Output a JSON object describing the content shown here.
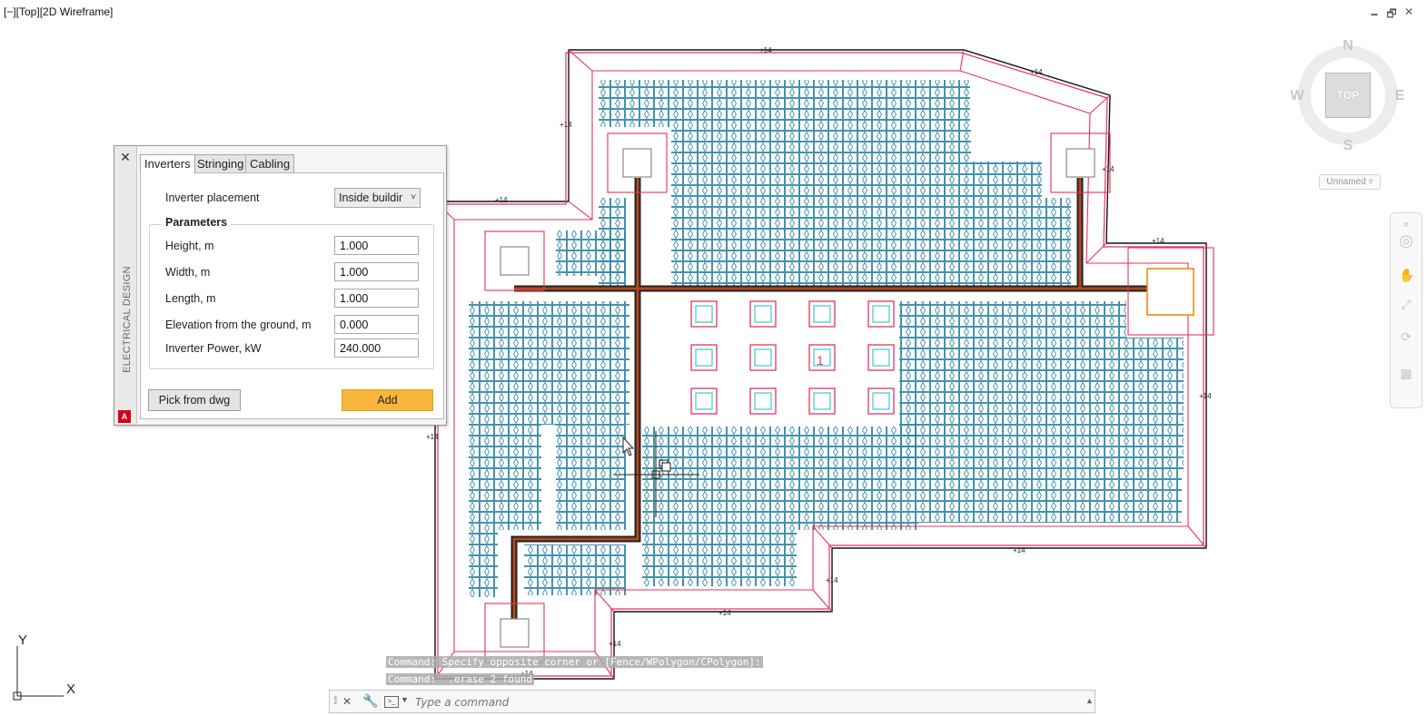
{
  "viewport": {
    "label": "[−][Top][2D Wireframe]"
  },
  "window_controls": {
    "minimize": "🗕",
    "restore": "🗗",
    "close": "✕"
  },
  "viewcube": {
    "north": "N",
    "south": "S",
    "east": "E",
    "west": "W",
    "face": "TOP",
    "view_name": "Unnamed ▿"
  },
  "ucs": {
    "y": "Y",
    "x": "X"
  },
  "drawing": {
    "dimension_label": "+14",
    "inverter_number": "1"
  },
  "panel": {
    "close": "✕",
    "vertical_title": "ELECTRICAL DESIGN",
    "logo": "A",
    "tabs": [
      "Inverters",
      "Stringing",
      "Cabling"
    ],
    "inverter_placement_label": "Inverter placement",
    "inverter_placement_value": "Inside buildir",
    "parameters_title": "Parameters",
    "fields": [
      {
        "label": "Height, m",
        "value": "1.000"
      },
      {
        "label": "Width, m",
        "value": "1.000"
      },
      {
        "label": "Length, m",
        "value": "1.000"
      },
      {
        "label": "Elevation from the ground, m",
        "value": "0.000"
      },
      {
        "label": "Inverter Power, kW",
        "value": "240.000"
      }
    ],
    "pick_button": "Pick from dwg",
    "add_button": "Add"
  },
  "command": {
    "history": [
      "Command: Specify opposite corner or [Fence/WPolygon/CPolygon]:",
      "Command:  .erase 2 found"
    ],
    "placeholder": "Type a command"
  }
}
